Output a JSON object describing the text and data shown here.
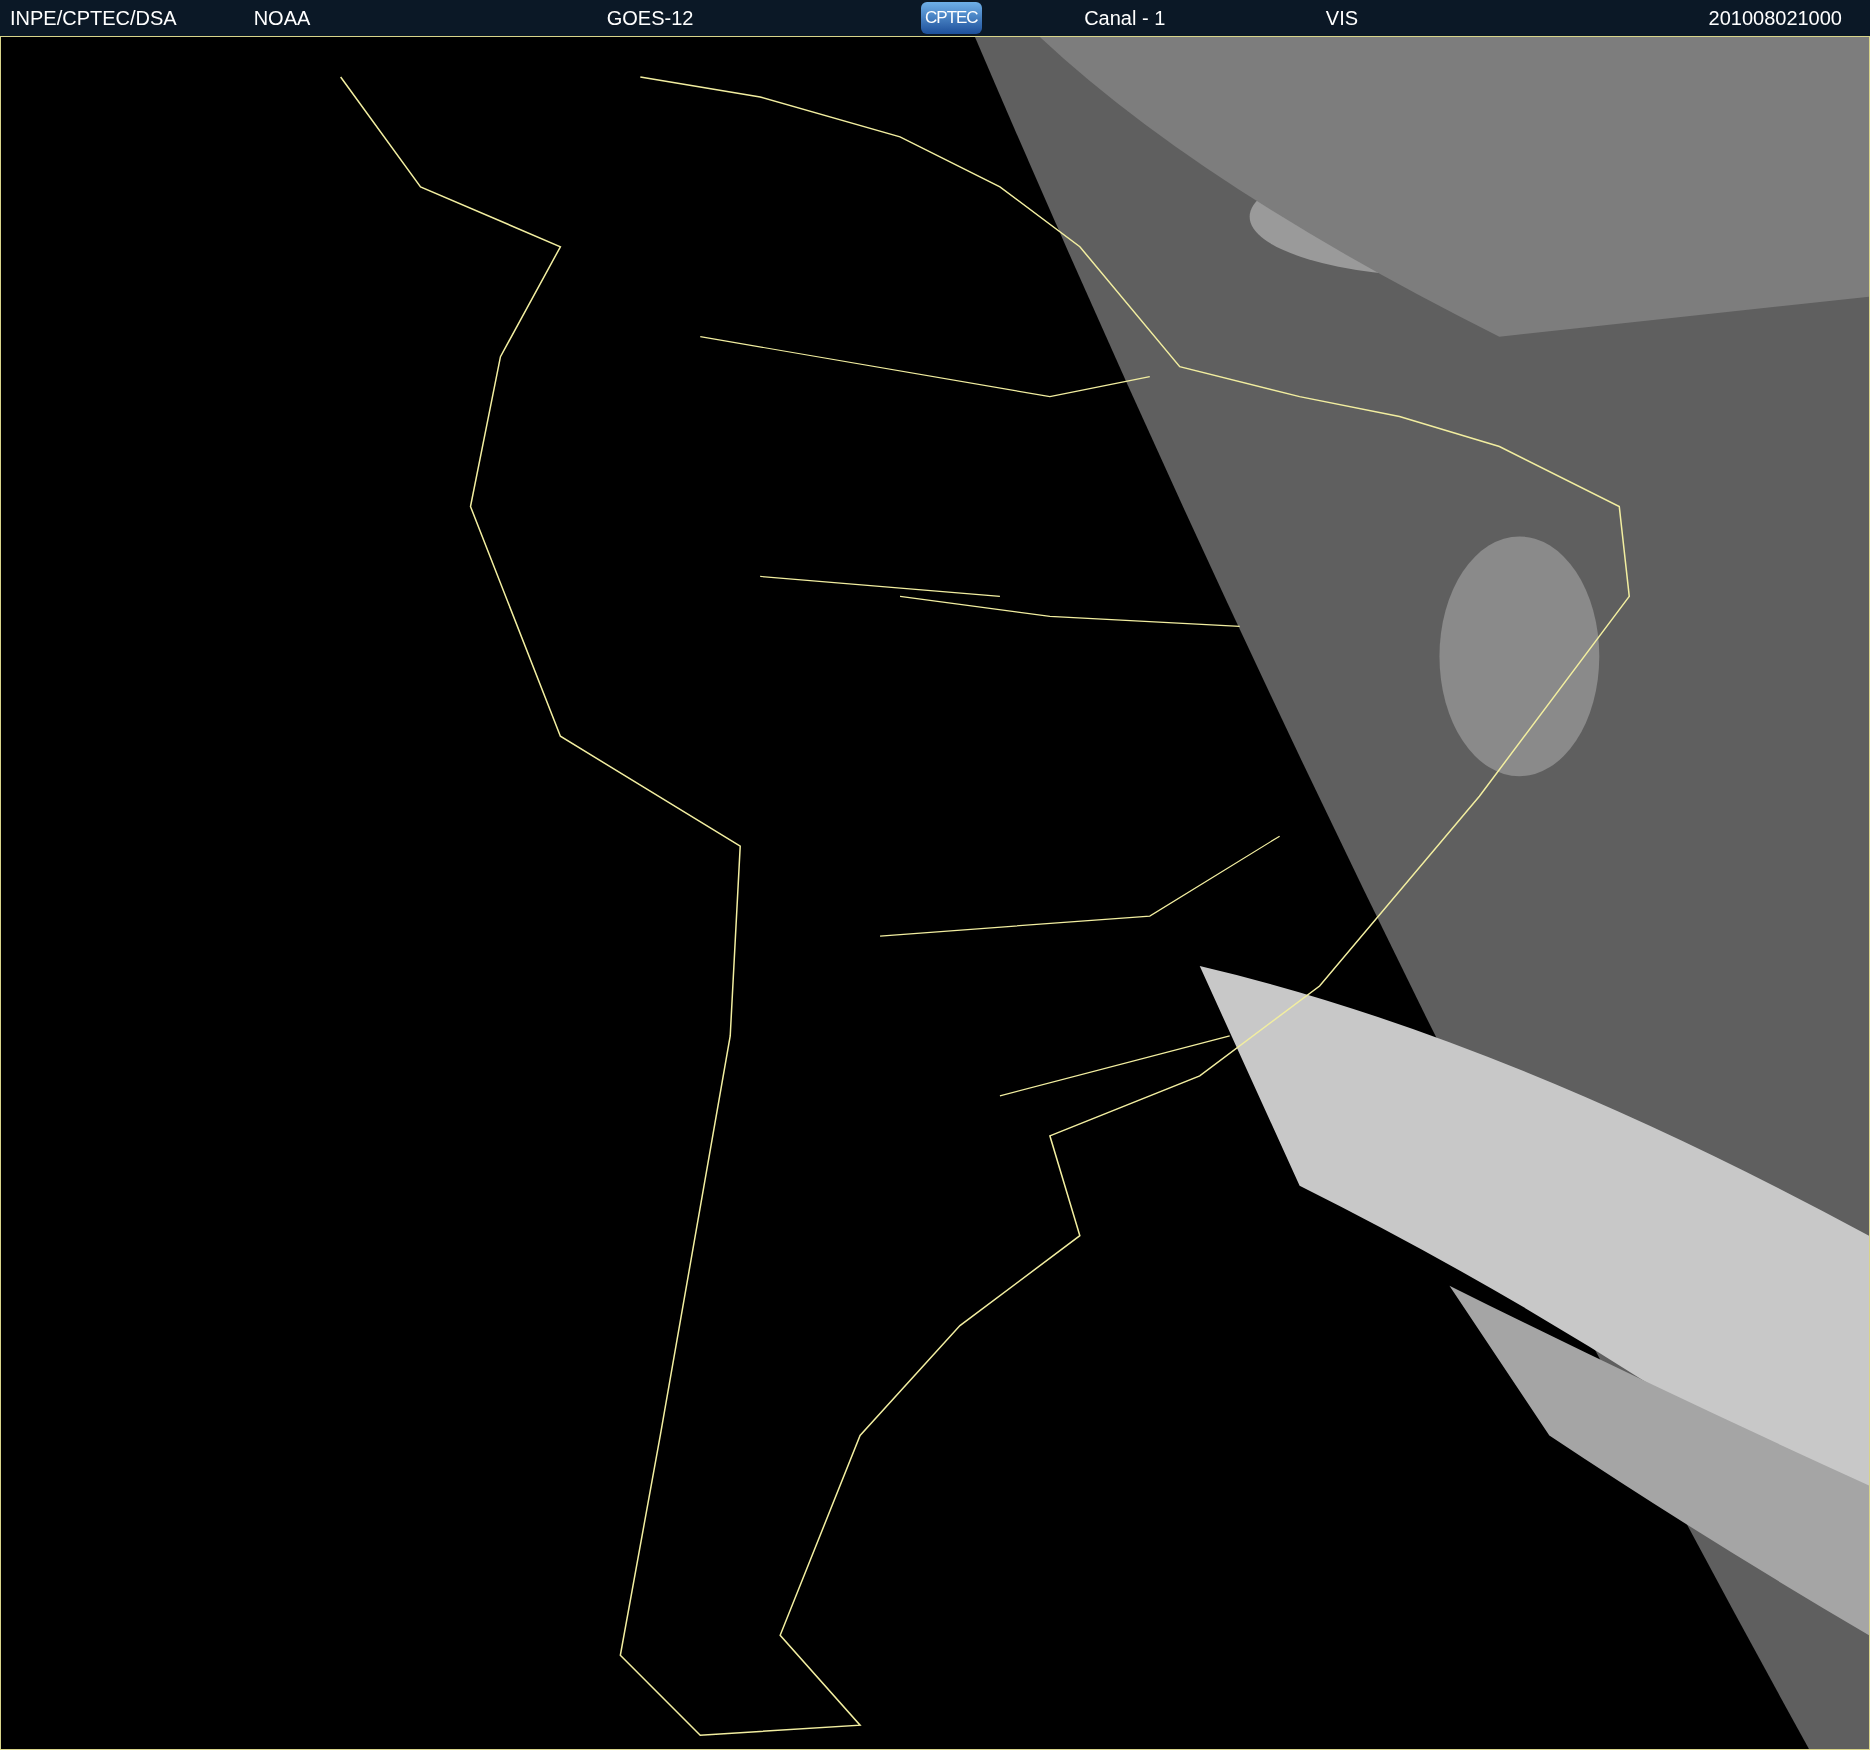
{
  "header": {
    "items": [
      {
        "kind": "label",
        "text": "INPE/CPTEC/DSA"
      },
      {
        "kind": "label",
        "text": "NOAA"
      },
      {
        "kind": "label",
        "text": "GOES-12"
      },
      {
        "kind": "logo",
        "text": "CPTEC"
      },
      {
        "kind": "label",
        "text": "Canal - 1"
      },
      {
        "kind": "label",
        "text": "VIS"
      },
      {
        "kind": "label",
        "text": "201008021000"
      }
    ]
  }
}
